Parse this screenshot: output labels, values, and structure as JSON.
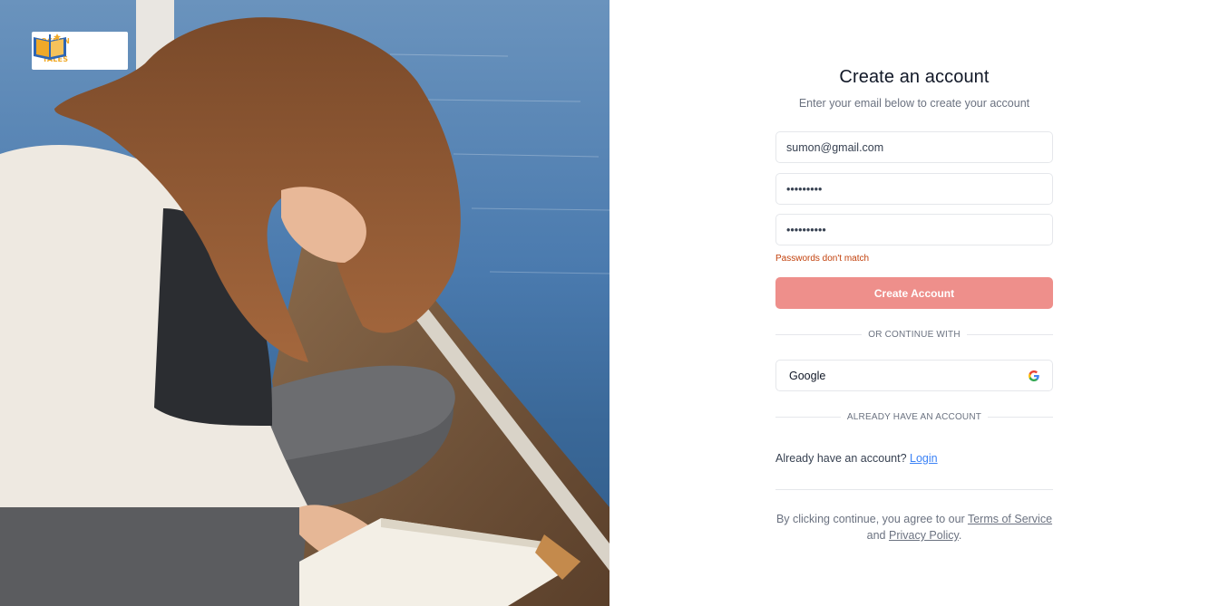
{
  "brand": {
    "logo_lines": [
      "OCEAN",
      "OF",
      "TALES"
    ],
    "accent": "#f0a928"
  },
  "form": {
    "title": "Create an account",
    "subtitle": "Enter your email below to create your account",
    "email_value": "sumon@gmail.com",
    "password_value": "•••••••••",
    "confirm_password_value": "••••••••••",
    "error_text": "Passwords don't match",
    "submit_label": "Create Account",
    "divider_continue": "OR CONTINUE WITH",
    "google_label": "Google",
    "divider_account": "ALREADY HAVE AN ACCOUNT",
    "already_text": "Already have an account?",
    "login_link": "Login",
    "terms_prefix": "By clicking continue, you agree to our",
    "terms_link": "Terms of Service",
    "terms_and": "and",
    "privacy_link": "Privacy Policy",
    "terms_suffix": "."
  },
  "colors": {
    "primary_button": "#ee8f8b",
    "error": "#c2410c",
    "link": "#3b82f6"
  },
  "icons": {
    "google": "google-icon",
    "logo": "book-icon"
  }
}
